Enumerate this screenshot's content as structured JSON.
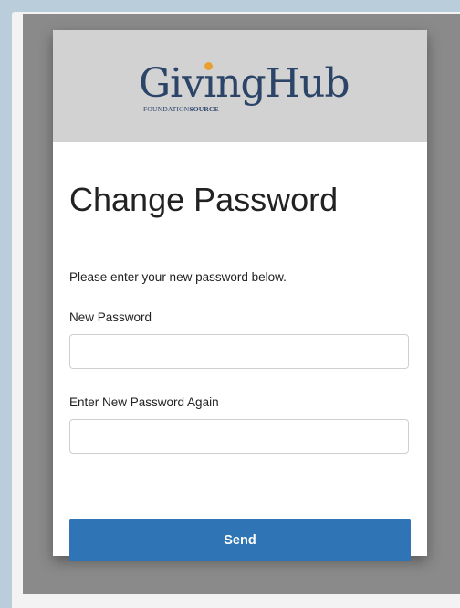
{
  "brand": {
    "name": "GivingHub",
    "name_part1": "Giv",
    "name_part2": "ng",
    "name_part3": "Hub",
    "tagline_light": "FOUNDATION",
    "tagline_bold": "SOURCE",
    "text_color": "#2b4468",
    "accent_color": "#e8a033"
  },
  "form": {
    "title": "Change Password",
    "intro": "Please enter your new password below.",
    "new_password_label": "New Password",
    "new_password_value": "",
    "confirm_password_label": "Enter New Password Again",
    "confirm_password_value": "",
    "send_label": "Send",
    "send_color": "#2f75b5"
  }
}
